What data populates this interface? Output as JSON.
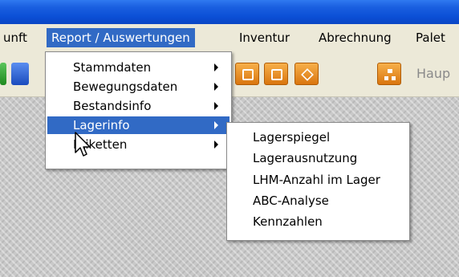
{
  "menubar": {
    "items": [
      {
        "label": "unft"
      },
      {
        "label": "Report / Auswertungen"
      },
      {
        "label": "Inventur"
      },
      {
        "label": "Abrechnung"
      },
      {
        "label": "Palet"
      }
    ]
  },
  "toolbar": {
    "haupt_label": "Haup",
    "icons": [
      "green-icon",
      "blue-arrows-icon",
      "copy-icon",
      "paste-icon",
      "diamond-icon",
      "hierarchy-icon"
    ]
  },
  "report_menu": {
    "items": [
      {
        "label": "Stammdaten"
      },
      {
        "label": "Bewegungsdaten"
      },
      {
        "label": "Bestandsinfo"
      },
      {
        "label": "Lagerinfo"
      },
      {
        "label": "Etiketten"
      }
    ]
  },
  "lagerinfo_submenu": {
    "items": [
      {
        "label": "Lagerspiegel"
      },
      {
        "label": "Lagerausnutzung"
      },
      {
        "label": "LHM-Anzahl im Lager"
      },
      {
        "label": "ABC-Analyse"
      },
      {
        "label": "Kennzahlen"
      }
    ]
  },
  "colors": {
    "title_blue": "#0b4fd6",
    "menu_bg": "#ece9d8",
    "highlight": "#316ac5",
    "toolbar_orange": "#e8902a"
  }
}
